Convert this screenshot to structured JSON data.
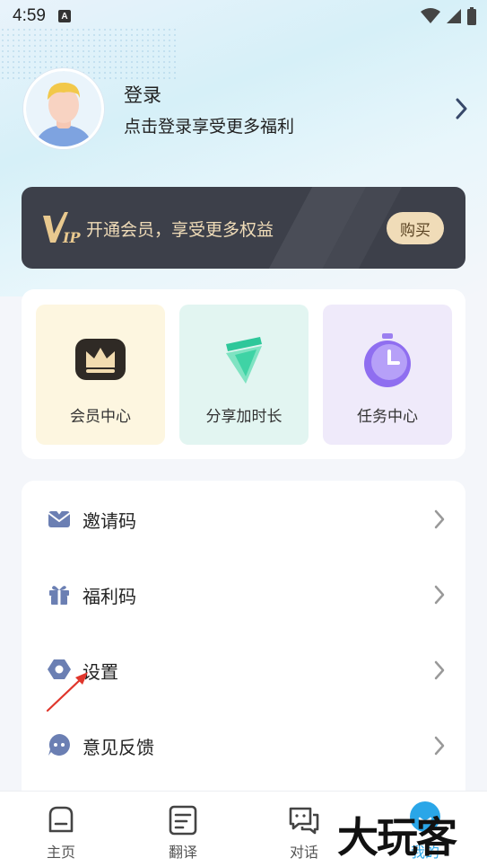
{
  "status_bar": {
    "time": "4:59",
    "badge": "A"
  },
  "profile": {
    "title": "登录",
    "subtitle": "点击登录享受更多福利"
  },
  "vip": {
    "text": "开通会员，享受更多权益",
    "buy_label": "购买",
    "colors": {
      "background": "#3d404a",
      "gold": "#f0dcb8"
    }
  },
  "features": [
    {
      "label": "会员中心",
      "icon": "crown-icon"
    },
    {
      "label": "分享加时长",
      "icon": "share-arrow-icon"
    },
    {
      "label": "任务中心",
      "icon": "timer-icon"
    }
  ],
  "menu": [
    {
      "label": "邀请码",
      "icon": "invite-envelope-icon"
    },
    {
      "label": "福利码",
      "icon": "gift-icon"
    },
    {
      "label": "设置",
      "icon": "settings-icon"
    },
    {
      "label": "意见反馈",
      "icon": "feedback-icon"
    }
  ],
  "tabs": [
    {
      "label": "主页",
      "icon": "home-icon"
    },
    {
      "label": "翻译",
      "icon": "translate-icon"
    },
    {
      "label": "对话",
      "icon": "chat-icon"
    },
    {
      "label": "我的",
      "icon": "profile-icon",
      "active": true
    }
  ],
  "watermark": "大玩客",
  "accent_color": "#2aa6e8"
}
